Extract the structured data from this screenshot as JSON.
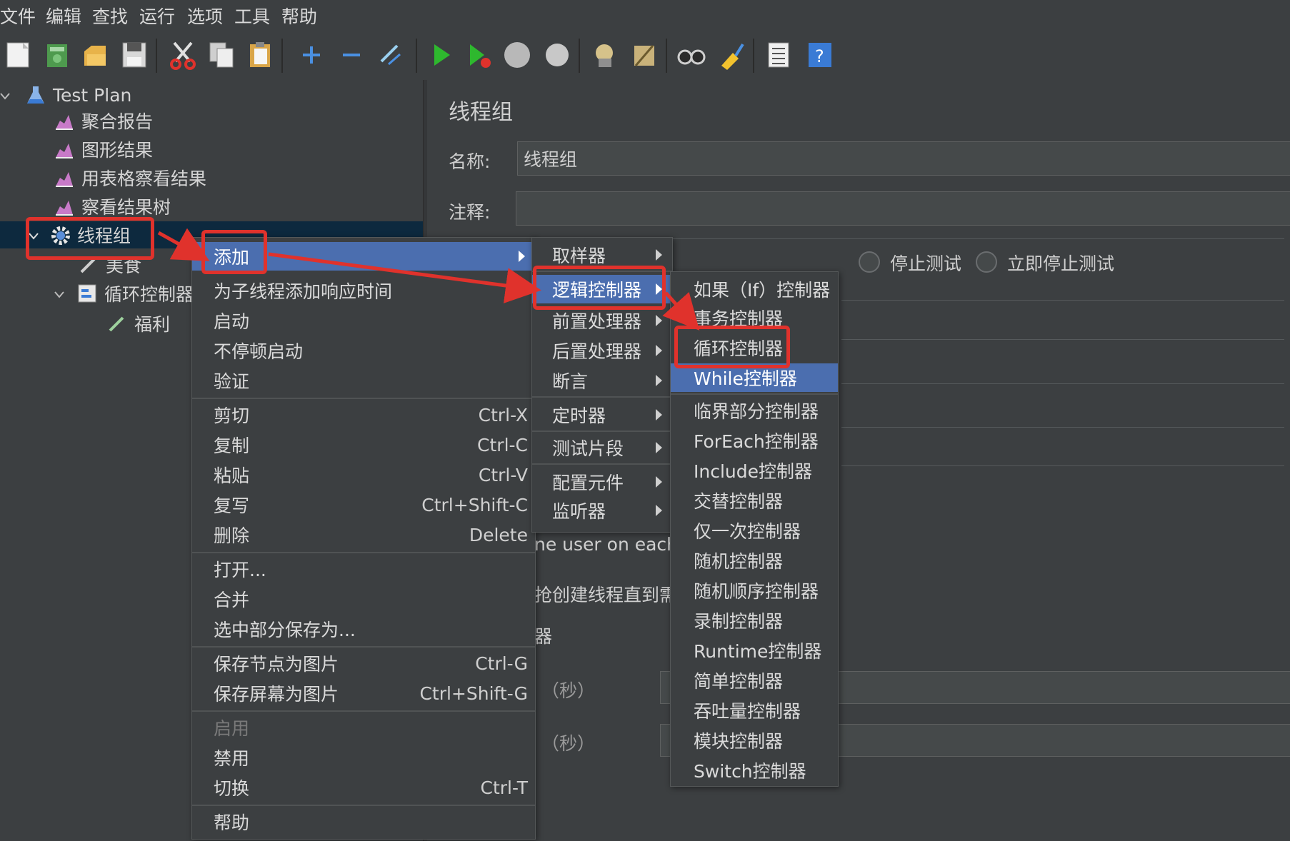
{
  "menubar": [
    "文件",
    "编辑",
    "查找",
    "运行",
    "选项",
    "工具",
    "帮助"
  ],
  "toolbar_icons": [
    "new-icon",
    "templates-icon",
    "open-icon",
    "save-icon",
    "cut-icon",
    "copy-icon",
    "paste-icon",
    "expand-icon",
    "collapse-icon",
    "toggle-icon",
    "start-icon",
    "start-no-pause-icon",
    "stop-icon",
    "shutdown-icon",
    "clear-icon",
    "clear-all-icon",
    "search-icon",
    "reset-search-icon",
    "function-helper-icon",
    "help-icon"
  ],
  "tree": {
    "test_plan": "Test Plan",
    "items": [
      "聚合报告",
      "图形结果",
      "用表格察看结果",
      "察看结果树"
    ],
    "thread_group": "线程组",
    "child_partial": "美食",
    "loop_controller": "循环控制器",
    "sampler": "福利"
  },
  "panel": {
    "title": "线程组",
    "name_label": "名称:",
    "name_value": "线程组",
    "comment_label": "注释:",
    "stop_test": "停止测试",
    "stop_test_now": "立即停止测试",
    "partial_same_user": "ne user on each ite",
    "partial_delay": "抢创建线程直到需要",
    "partial_scheduler": "器",
    "seconds_1": "（秒）",
    "seconds_2": "（秒）"
  },
  "context_menu": {
    "add": "添加",
    "items": [
      {
        "label": "为子线程添加响应时间",
        "shortcut": ""
      },
      {
        "label": "启动",
        "shortcut": ""
      },
      {
        "label": "不停顿启动",
        "shortcut": ""
      },
      {
        "label": "验证",
        "shortcut": ""
      },
      {
        "label": "剪切",
        "shortcut": "Ctrl-X"
      },
      {
        "label": "复制",
        "shortcut": "Ctrl-C"
      },
      {
        "label": "粘贴",
        "shortcut": "Ctrl-V"
      },
      {
        "label": "复写",
        "shortcut": "Ctrl+Shift-C"
      },
      {
        "label": "删除",
        "shortcut": "Delete"
      },
      {
        "label": "打开...",
        "shortcut": ""
      },
      {
        "label": "合并",
        "shortcut": ""
      },
      {
        "label": "选中部分保存为...",
        "shortcut": ""
      },
      {
        "label": "保存节点为图片",
        "shortcut": "Ctrl-G"
      },
      {
        "label": "保存屏幕为图片",
        "shortcut": "Ctrl+Shift-G"
      },
      {
        "label": "启用",
        "shortcut": ""
      },
      {
        "label": "禁用",
        "shortcut": ""
      },
      {
        "label": "切换",
        "shortcut": "Ctrl-T"
      },
      {
        "label": "帮助",
        "shortcut": ""
      }
    ]
  },
  "add_submenu": [
    "取样器",
    "逻辑控制器",
    "前置处理器",
    "后置处理器",
    "断言",
    "定时器",
    "测试片段",
    "配置元件",
    "监听器"
  ],
  "logic_submenu": [
    "如果（If）控制器",
    "事务控制器",
    "循环控制器",
    "While控制器",
    "临界部分控制器",
    "ForEach控制器",
    "Include控制器",
    "交替控制器",
    "仅一次控制器",
    "随机控制器",
    "随机顺序控制器",
    "录制控制器",
    "Runtime控制器",
    "简单控制器",
    "吞吐量控制器",
    "模块控制器",
    "Switch控制器"
  ],
  "colors": {
    "highlight": "#4b6eaf",
    "annotation_red": "#e0322c",
    "background": "#3c3f41"
  }
}
